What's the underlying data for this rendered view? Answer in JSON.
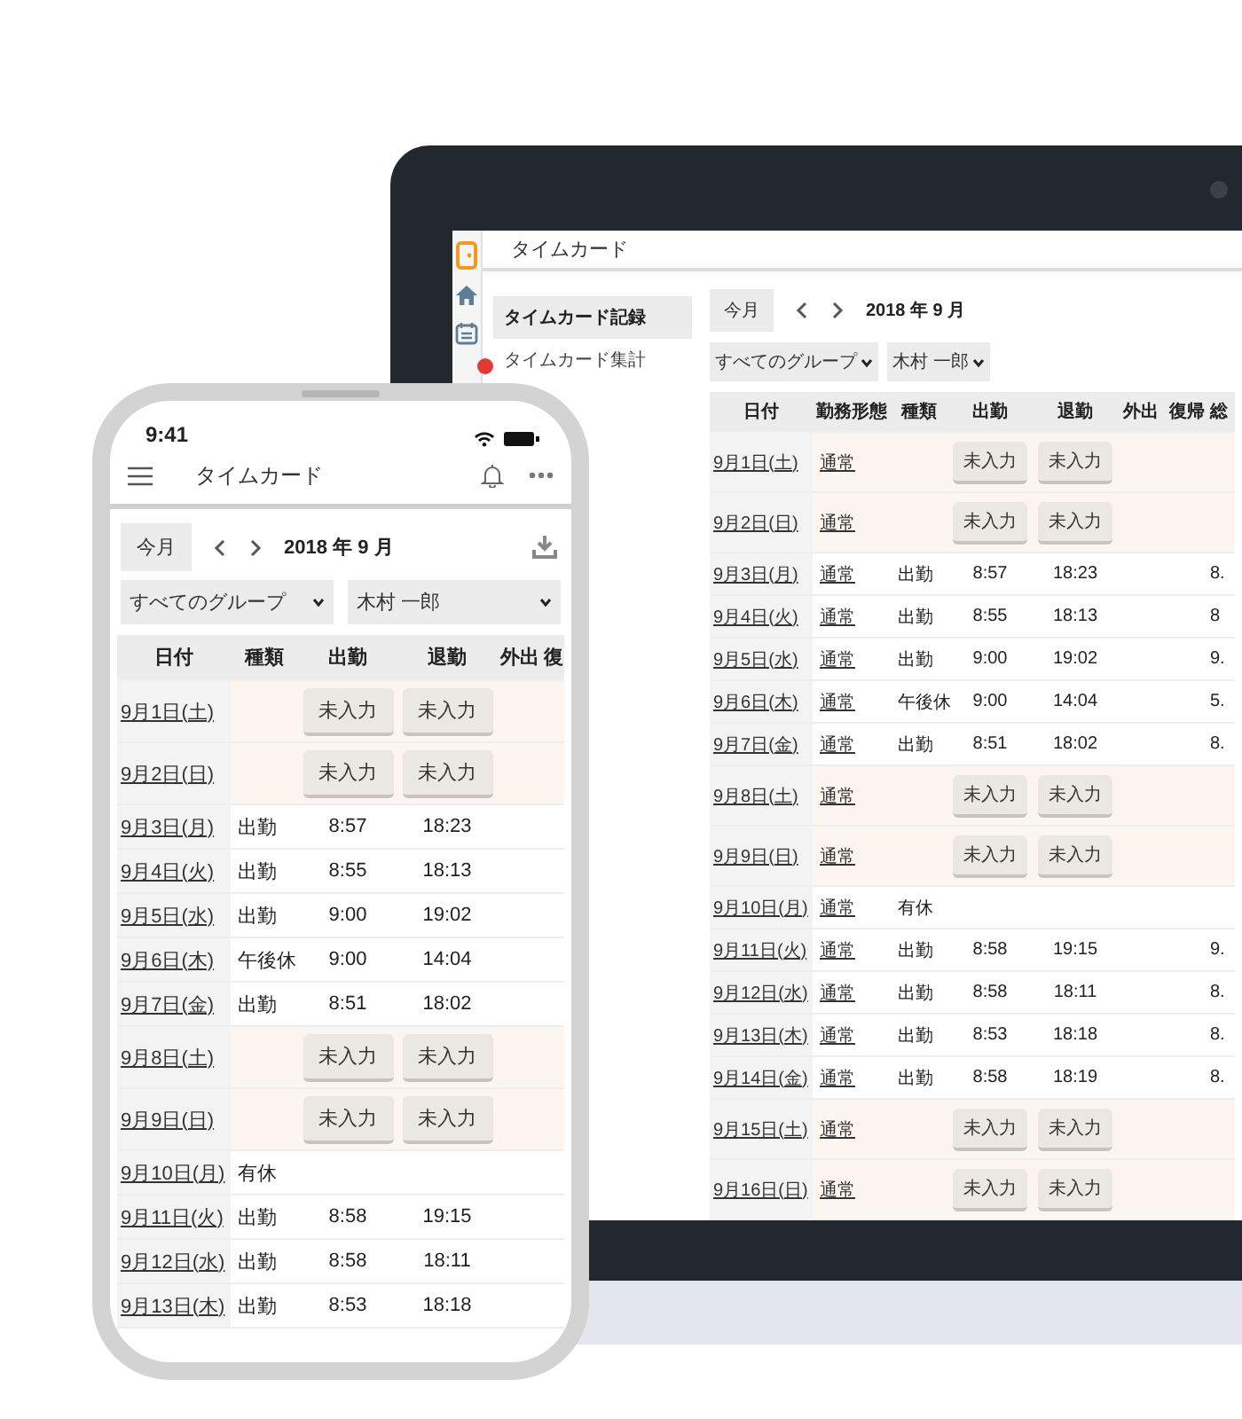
{
  "laptop": {
    "app_title": "タイムカード",
    "sidebar": {
      "items": [
        {
          "label": "タイムカード記録",
          "selected": true
        },
        {
          "label": "タイムカード集計",
          "selected": false
        }
      ]
    },
    "toolbar": {
      "today_button": "今月",
      "period": "2018 年 9 月",
      "group_select": "すべてのグループ",
      "person_select": "木村 一郎"
    },
    "table": {
      "columns": [
        "日付",
        "勤務形態",
        "種類",
        "出勤",
        "退勤",
        "外出",
        "復帰",
        "総"
      ],
      "rows": [
        {
          "kind": "unentered",
          "date": "9月1日(土)",
          "work_pattern": "通常",
          "clock_in": "未入力",
          "clock_out": "未入力"
        },
        {
          "kind": "unentered",
          "date": "9月2日(日)",
          "work_pattern": "通常",
          "clock_in": "未入力",
          "clock_out": "未入力"
        },
        {
          "kind": "recorded",
          "date": "9月3日(月)",
          "work_pattern": "通常",
          "type": "出勤",
          "clock_in": "8:57",
          "clock_out": "18:23",
          "column_8": "8."
        },
        {
          "kind": "recorded",
          "date": "9月4日(火)",
          "work_pattern": "通常",
          "type": "出勤",
          "clock_in": "8:55",
          "clock_out": "18:13",
          "column_8": "8"
        },
        {
          "kind": "recorded",
          "date": "9月5日(水)",
          "work_pattern": "通常",
          "type": "出勤",
          "clock_in": "9:00",
          "clock_out": "19:02",
          "column_8": "9."
        },
        {
          "kind": "recorded",
          "date": "9月6日(木)",
          "work_pattern": "通常",
          "type": "午後休",
          "clock_in": "9:00",
          "clock_out": "14:04",
          "column_8": "5."
        },
        {
          "kind": "recorded",
          "date": "9月7日(金)",
          "work_pattern": "通常",
          "type": "出勤",
          "clock_in": "8:51",
          "clock_out": "18:02",
          "column_8": "8."
        },
        {
          "kind": "unentered",
          "date": "9月8日(土)",
          "work_pattern": "通常",
          "clock_in": "未入力",
          "clock_out": "未入力"
        },
        {
          "kind": "unentered",
          "date": "9月9日(日)",
          "work_pattern": "通常",
          "clock_in": "未入力",
          "clock_out": "未入力"
        },
        {
          "kind": "recorded",
          "date": "9月10日(月)",
          "work_pattern": "通常",
          "type": "有休"
        },
        {
          "kind": "recorded",
          "date": "9月11日(火)",
          "work_pattern": "通常",
          "type": "出勤",
          "clock_in": "8:58",
          "clock_out": "19:15",
          "column_8": "9."
        },
        {
          "kind": "recorded",
          "date": "9月12日(水)",
          "work_pattern": "通常",
          "type": "出勤",
          "clock_in": "8:58",
          "clock_out": "18:11",
          "column_8": "8."
        },
        {
          "kind": "recorded",
          "date": "9月13日(木)",
          "work_pattern": "通常",
          "type": "出勤",
          "clock_in": "8:53",
          "clock_out": "18:18",
          "column_8": "8."
        },
        {
          "kind": "recorded",
          "date": "9月14日(金)",
          "work_pattern": "通常",
          "type": "出勤",
          "clock_in": "8:58",
          "clock_out": "18:19",
          "column_8": "8."
        },
        {
          "kind": "unentered",
          "date": "9月15日(土)",
          "work_pattern": "通常",
          "clock_in": "未入力",
          "clock_out": "未入力"
        },
        {
          "kind": "unentered",
          "date": "9月16日(日)",
          "work_pattern": "通常",
          "clock_in": "未入力",
          "clock_out": "未入力"
        }
      ]
    }
  },
  "phone": {
    "status_bar": {
      "time": "9:41"
    },
    "app_title": "タイムカード",
    "toolbar": {
      "today_button": "今月",
      "period": "2018 年 9 月",
      "group_select": "すべてのグループ",
      "person_select": "木村 一郎"
    },
    "table": {
      "columns": [
        "日付",
        "種類",
        "出勤",
        "退勤",
        "外出",
        "復"
      ],
      "rows": [
        {
          "kind": "unentered",
          "date": "9月1日(土)",
          "clock_in": "未入力",
          "clock_out": "未入力"
        },
        {
          "kind": "unentered",
          "date": "9月2日(日)",
          "clock_in": "未入力",
          "clock_out": "未入力"
        },
        {
          "kind": "recorded",
          "date": "9月3日(月)",
          "type": "出勤",
          "clock_in": "8:57",
          "clock_out": "18:23"
        },
        {
          "kind": "recorded",
          "date": "9月4日(火)",
          "type": "出勤",
          "clock_in": "8:55",
          "clock_out": "18:13"
        },
        {
          "kind": "recorded",
          "date": "9月5日(水)",
          "type": "出勤",
          "clock_in": "9:00",
          "clock_out": "19:02"
        },
        {
          "kind": "recorded",
          "date": "9月6日(木)",
          "type": "午後休",
          "clock_in": "9:00",
          "clock_out": "14:04"
        },
        {
          "kind": "recorded",
          "date": "9月7日(金)",
          "type": "出勤",
          "clock_in": "8:51",
          "clock_out": "18:02"
        },
        {
          "kind": "unentered",
          "date": "9月8日(土)",
          "clock_in": "未入力",
          "clock_out": "未入力"
        },
        {
          "kind": "unentered",
          "date": "9月9日(日)",
          "clock_in": "未入力",
          "clock_out": "未入力"
        },
        {
          "kind": "recorded",
          "date": "9月10日(月)",
          "type": "有休"
        },
        {
          "kind": "recorded",
          "date": "9月11日(火)",
          "type": "出勤",
          "clock_in": "8:58",
          "clock_out": "19:15"
        },
        {
          "kind": "recorded",
          "date": "9月12日(水)",
          "type": "出勤",
          "clock_in": "8:58",
          "clock_out": "18:11"
        },
        {
          "kind": "recorded",
          "date": "9月13日(木)",
          "type": "出勤",
          "clock_in": "8:53",
          "clock_out": "18:18"
        }
      ]
    }
  }
}
